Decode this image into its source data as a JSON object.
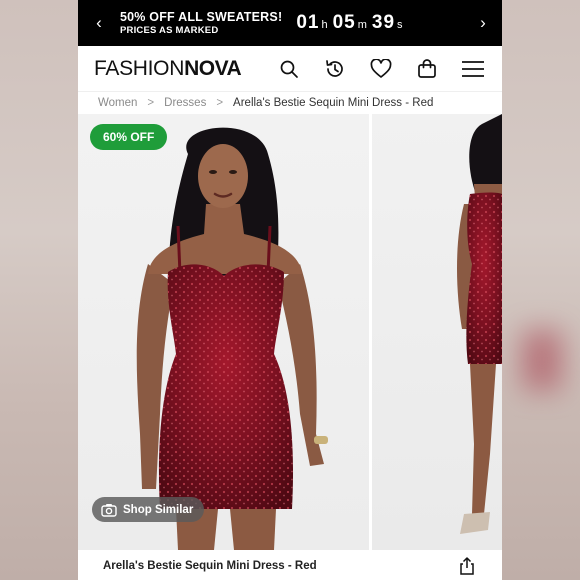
{
  "promo": {
    "title": "50% OFF ALL SWEATERS!",
    "subtitle": "PRICES AS MARKED",
    "timer": {
      "hours": "01",
      "hours_unit": "h",
      "minutes": "05",
      "minutes_unit": "m",
      "seconds": "39",
      "seconds_unit": "s"
    },
    "prev_icon": "chevron-left-icon",
    "next_icon": "chevron-right-icon"
  },
  "header": {
    "logo_light": "FASHION",
    "logo_bold": "NOVA",
    "icons": [
      "search-icon",
      "history-icon",
      "heart-icon",
      "bag-icon",
      "menu-icon"
    ]
  },
  "breadcrumb": {
    "items": [
      "Women",
      "Dresses",
      "Arella's Bestie Sequin Mini Dress - Red"
    ],
    "separator": ">"
  },
  "gallery": {
    "badge": "60% OFF",
    "shop_similar": "Shop Similar",
    "dress_color": "#7a1020"
  },
  "product": {
    "name": "Arella's Bestie Sequin Mini Dress - Red",
    "share_icon": "share-icon"
  },
  "colors": {
    "sale_green": "#1f9d3a",
    "banner_black": "#000000"
  }
}
